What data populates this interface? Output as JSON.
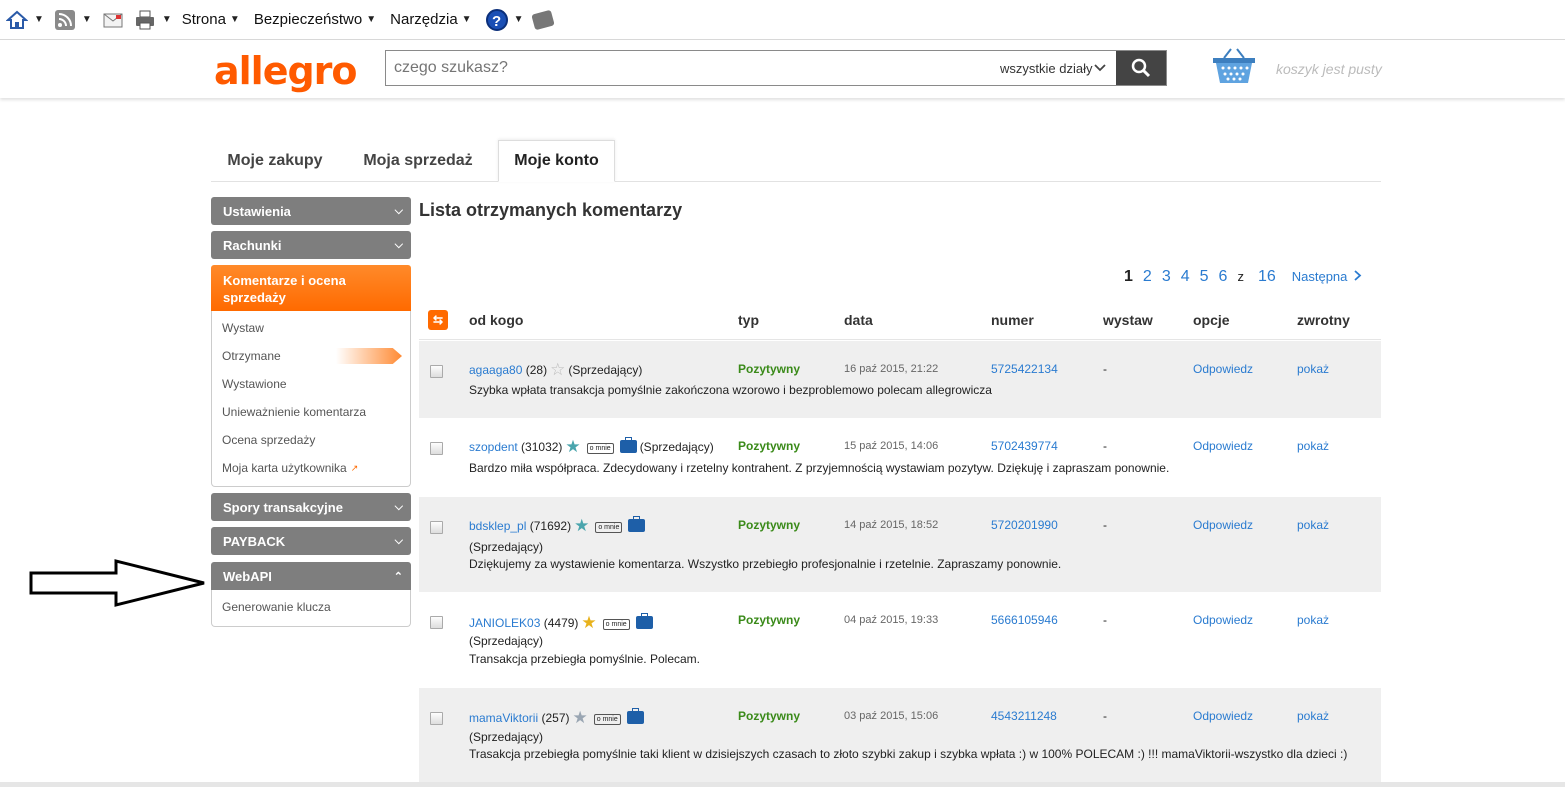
{
  "browser_bar": {
    "menus": [
      "Strona",
      "Bezpieczeństwo",
      "Narzędzia"
    ],
    "help_label": "?"
  },
  "header": {
    "logo": "allegro",
    "search_placeholder": "czego szukasz?",
    "department": "wszystkie działy",
    "cart_text": "koszyk jest pusty"
  },
  "tabs": [
    "Moje zakupy",
    "Moja sprzedaż",
    "Moje konto"
  ],
  "sidebar": {
    "sections": [
      {
        "label": "Ustawienia"
      },
      {
        "label": "Rachunki"
      },
      {
        "label": "Komentarze i ocena sprzedaży",
        "items": [
          "Wystaw",
          "Otrzymane",
          "Wystawione",
          "Unieważnienie komentarza",
          "Ocena sprzedaży",
          "Moja karta użytkownika"
        ]
      },
      {
        "label": "Spory transakcyjne"
      },
      {
        "label": "PAYBACK"
      },
      {
        "label": "WebAPI",
        "items": [
          "Generowanie klucza"
        ]
      }
    ]
  },
  "page_title": "Lista otrzymanych komentarzy",
  "pagination": {
    "current": "1",
    "pages": [
      "2",
      "3",
      "4",
      "5",
      "6"
    ],
    "of_label": "z",
    "total": "16",
    "next": "Następna"
  },
  "table": {
    "headers": [
      "od kogo",
      "typ",
      "data",
      "numer",
      "wystaw",
      "opcje",
      "zwrotny"
    ],
    "rows": [
      {
        "user": "agaaga80",
        "score": "(28)",
        "role": "(Sprzedający)",
        "type": "Pozytywny",
        "date": "16 paź 2015, 21:22",
        "number": "5725422134",
        "wystaw": "-",
        "option": "Odpowiedz",
        "zwrotny": "pokaż",
        "comment": "Szybka wpłata transakcja pomyślnie zakończona wzorowo i bezproblemowo polecam allegrowicza"
      },
      {
        "user": "szopdent",
        "score": "(31032)",
        "role": "(Sprzedający)",
        "type": "Pozytywny",
        "date": "15 paź 2015, 14:06",
        "number": "5702439774",
        "wystaw": "-",
        "option": "Odpowiedz",
        "zwrotny": "pokaż",
        "comment": "Bardzo miła współpraca. Zdecydowany i rzetelny kontrahent. Z przyjemnością wystawiam pozytyw. Dziękuję i zapraszam ponownie."
      },
      {
        "user": "bdsklep_pl",
        "score": "(71692)",
        "role": "(Sprzedający)",
        "type": "Pozytywny",
        "date": "14 paź 2015, 18:52",
        "number": "5720201990",
        "wystaw": "-",
        "option": "Odpowiedz",
        "zwrotny": "pokaż",
        "comment": "Dziękujemy za wystawienie komentarza. Wszystko przebiegło profesjonalnie i rzetelnie. Zapraszamy ponownie."
      },
      {
        "user": "JANIOLEK03",
        "score": "(4479)",
        "role": "(Sprzedający)",
        "type": "Pozytywny",
        "date": "04 paź 2015, 19:33",
        "number": "5666105946",
        "wystaw": "-",
        "option": "Odpowiedz",
        "zwrotny": "pokaż",
        "comment": "Transakcja przebiegła pomyślnie. Polecam."
      },
      {
        "user": "mamaViktorii",
        "score": "(257)",
        "role": "(Sprzedający)",
        "type": "Pozytywny",
        "date": "03 paź 2015, 15:06",
        "number": "4543211248",
        "wystaw": "-",
        "option": "Odpowiedz",
        "zwrotny": "pokaż",
        "comment": "Trasakcja przebiegła pomyślnie taki klient w dzisiejszych czasach to złoto szybki zakup i szybka wpłata :) w 100% POLECAM :) !!! mamaViktorii-wszystko dla dzieci :)"
      }
    ]
  },
  "badges": {
    "about_me": "o mnie"
  },
  "colors": {
    "brand": "#ff5a00",
    "link": "#2a7bd0",
    "positive": "#3a8a19",
    "sidebar_head": "#7e7e7e"
  }
}
